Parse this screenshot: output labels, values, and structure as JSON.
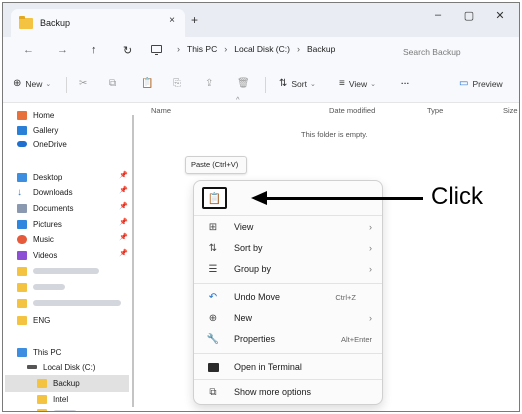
{
  "tab": {
    "title": "Backup",
    "close": "×",
    "new_tab": "+"
  },
  "window_controls": {
    "minimize": "–",
    "maximize": "▢",
    "close": "✕"
  },
  "nav": {
    "back": "←",
    "forward": "→",
    "up": "↑",
    "refresh": "↻"
  },
  "breadcrumb": [
    "This PC",
    "Local Disk (C:)",
    "Backup"
  ],
  "search": {
    "placeholder": "Search Backup"
  },
  "command_bar": {
    "new_label": "New",
    "sort_label": "Sort",
    "view_label": "View",
    "more_label": "···",
    "preview_label": "Preview"
  },
  "sidebar": {
    "items": [
      {
        "label": "Home",
        "icon": "home-icon",
        "color": "#e8703a"
      },
      {
        "label": "Gallery",
        "icon": "gallery-icon",
        "color": "#2a7fd6"
      },
      {
        "label": "OneDrive",
        "icon": "cloud-icon",
        "color": "#1e6fcf"
      },
      {
        "label": "Desktop",
        "icon": "desktop-icon",
        "color": "#3d8ee0",
        "pinned": true
      },
      {
        "label": "Downloads",
        "icon": "download-icon",
        "color": "#2a78cc",
        "pinned": true
      },
      {
        "label": "Documents",
        "icon": "documents-icon",
        "color": "#8a98b0",
        "pinned": true
      },
      {
        "label": "Pictures",
        "icon": "pictures-icon",
        "color": "#2e86de",
        "pinned": true
      },
      {
        "label": "Music",
        "icon": "music-icon",
        "color": "#e55b3c",
        "pinned": true
      },
      {
        "label": "Videos",
        "icon": "videos-icon",
        "color": "#8c4fd6",
        "pinned": true
      },
      {
        "label": "ENG",
        "icon": "folder-icon",
        "color": "#f5c342"
      },
      {
        "label": "This PC",
        "icon": "pc-icon",
        "color": "#3d8ee0"
      },
      {
        "label": "Local Disk (C:)",
        "icon": "drive-icon",
        "color": "#555555"
      },
      {
        "label": "Backup",
        "icon": "folder-icon",
        "color": "#f5c342"
      },
      {
        "label": "Intel",
        "icon": "folder-icon",
        "color": "#f5c342"
      }
    ]
  },
  "columns": {
    "name": "Name",
    "date_modified": "Date modified",
    "type": "Type",
    "size": "Size"
  },
  "empty_message": "This folder is empty.",
  "tooltip": "Paste (Ctrl+V)",
  "context_menu": {
    "paste_icon": "paste-icon",
    "items": [
      {
        "label": "View",
        "icon": "view-icon",
        "arrow": "›"
      },
      {
        "label": "Sort by",
        "icon": "sort-icon",
        "arrow": "›"
      },
      {
        "label": "Group by",
        "icon": "group-icon",
        "arrow": "›"
      },
      {
        "label": "Undo Move",
        "icon": "undo-icon",
        "shortcut": "Ctrl+Z"
      },
      {
        "label": "New",
        "icon": "new-icon",
        "arrow": "›"
      },
      {
        "label": "Properties",
        "icon": "properties-icon",
        "shortcut": "Alt+Enter"
      },
      {
        "label": "Open in Terminal",
        "icon": "terminal-icon"
      },
      {
        "label": "Show more options",
        "icon": "more-options-icon"
      }
    ]
  },
  "annotation": {
    "label": "Click"
  },
  "colors": {
    "folder": "#f5c342",
    "selected_bg": "#e1e1e1",
    "accent": "#1e6fcf"
  }
}
